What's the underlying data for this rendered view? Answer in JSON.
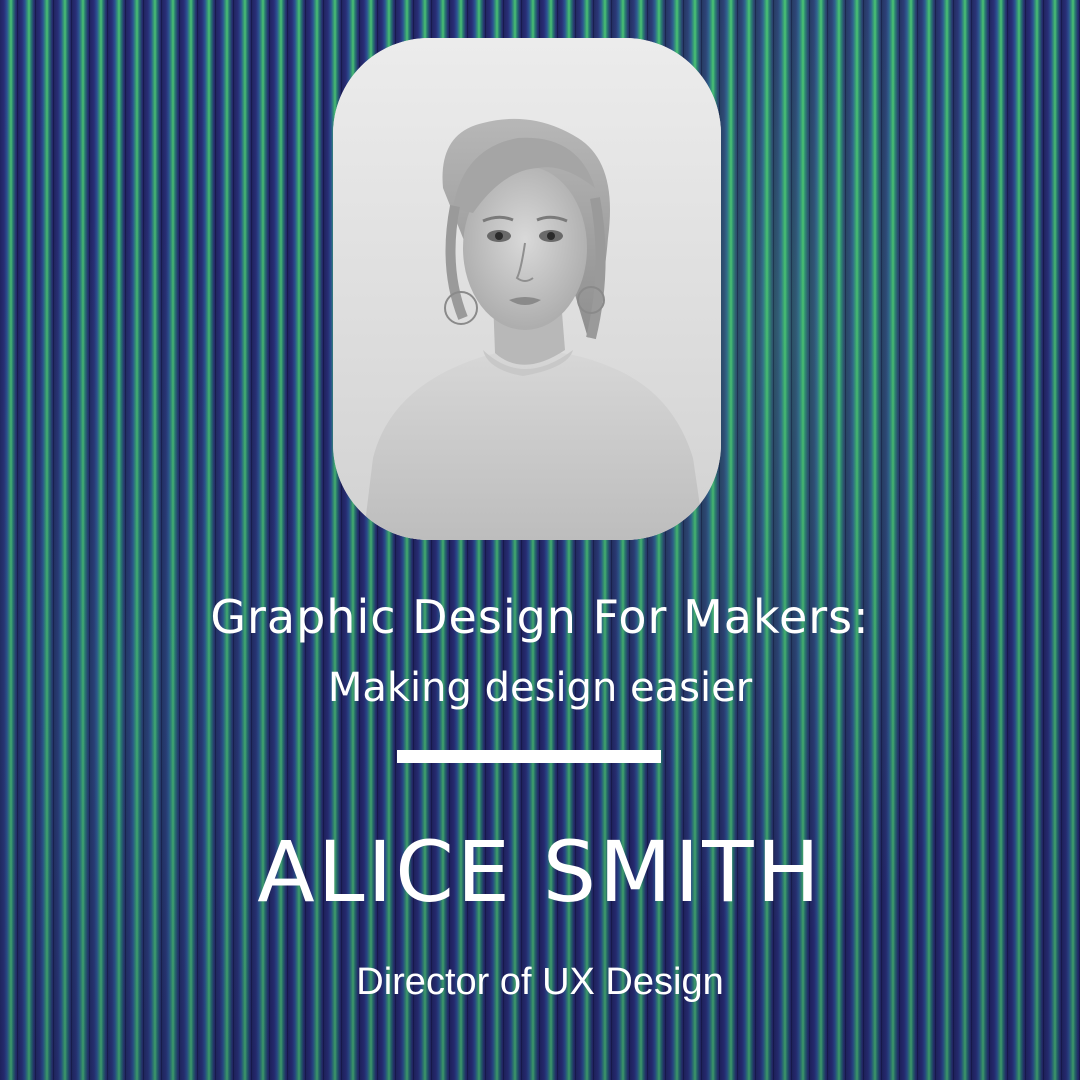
{
  "event": {
    "title": "Graphic Design For Makers:",
    "subtitle": "Making design easier"
  },
  "speaker": {
    "name": "ALICE SMITH",
    "role": "Director of UX Design",
    "photo": "portrait-photo"
  },
  "colors": {
    "background_stripe_blue": "#2d3380",
    "background_stripe_green": "#58e07d",
    "text": "#ffffff"
  }
}
